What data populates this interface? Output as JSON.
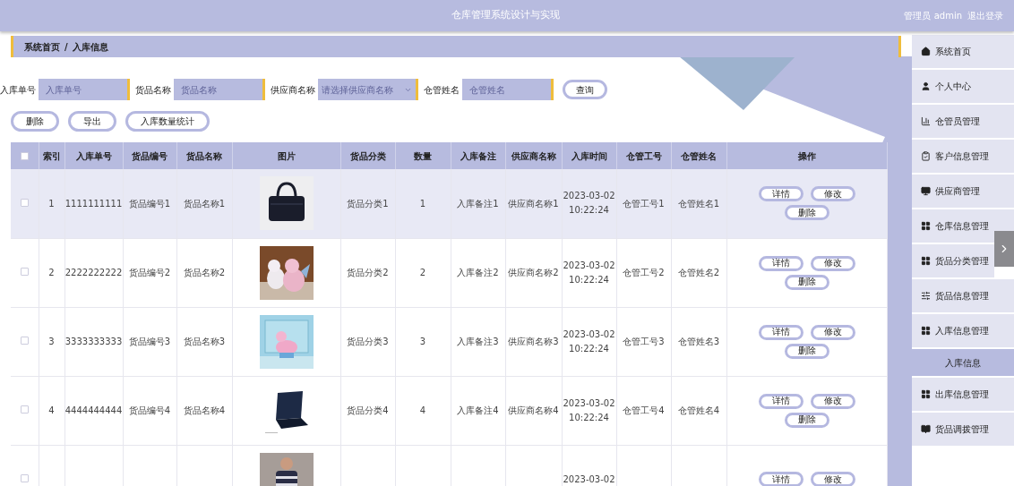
{
  "header": {
    "title": "仓库管理系统设计与实现",
    "user": "管理员 admin",
    "logout": "退出登录"
  },
  "breadcrumb": [
    "系统首页",
    "/",
    "入库信息"
  ],
  "search": [
    {
      "label": "入库单号",
      "placeholder": "入库单号",
      "kind": "input"
    },
    {
      "label": "货品名称",
      "placeholder": "货品名称",
      "kind": "input"
    },
    {
      "label": "供应商名称",
      "placeholder": "请选择供应商名称",
      "kind": "select"
    },
    {
      "label": "仓管姓名",
      "placeholder": "仓管姓名",
      "kind": "input"
    }
  ],
  "search_button": "查询",
  "actions": [
    "删除",
    "导出",
    "入库数量统计"
  ],
  "table": {
    "columns": [
      "索引",
      "入库单号",
      "货品编号",
      "货品名称",
      "图片",
      "货品分类",
      "数量",
      "入库备注",
      "供应商名称",
      "入库时间",
      "仓管工号",
      "仓管姓名",
      "操作"
    ],
    "header_checked": false,
    "rows": [
      {
        "highlighted": true,
        "checked": false,
        "index": "1",
        "order_no": "1111111111",
        "goods_no": "货品编号1",
        "goods_name": "货品名称1",
        "category": "货品分类1",
        "quantity": "1",
        "remark": "入库备注1",
        "supplier": "供应商名称1",
        "date": "2023-03-02",
        "time": "10:22:24",
        "keeper_no": "仓管工号1",
        "keeper_name": "仓管姓名1",
        "buttons": [
          "详情",
          "修改",
          "删除"
        ]
      },
      {
        "highlighted": false,
        "checked": false,
        "index": "2",
        "order_no": "2222222222",
        "goods_no": "货品编号2",
        "goods_name": "货品名称2",
        "category": "货品分类2",
        "quantity": "2",
        "remark": "入库备注2",
        "supplier": "供应商名称2",
        "date": "2023-03-02",
        "time": "10:22:24",
        "keeper_no": "仓管工号2",
        "keeper_name": "仓管姓名2",
        "buttons": [
          "详情",
          "修改",
          "删除"
        ]
      },
      {
        "highlighted": false,
        "checked": false,
        "index": "3",
        "order_no": "3333333333",
        "goods_no": "货品编号3",
        "goods_name": "货品名称3",
        "category": "货品分类3",
        "quantity": "3",
        "remark": "入库备注3",
        "supplier": "供应商名称3",
        "date": "2023-03-02",
        "time": "10:22:24",
        "keeper_no": "仓管工号3",
        "keeper_name": "仓管姓名3",
        "buttons": [
          "详情",
          "修改",
          "删除"
        ]
      },
      {
        "highlighted": false,
        "checked": false,
        "index": "4",
        "order_no": "4444444444",
        "goods_no": "货品编号4",
        "goods_name": "货品名称4",
        "category": "货品分类4",
        "quantity": "4",
        "remark": "入库备注4",
        "supplier": "供应商名称4",
        "date": "2023-03-02",
        "time": "10:22:24",
        "keeper_no": "仓管工号4",
        "keeper_name": "仓管姓名4",
        "buttons": [
          "详情",
          "修改",
          "删除"
        ]
      },
      {
        "highlighted": false,
        "checked": false,
        "date": "2023-03-02",
        "buttons": [
          "详情",
          "修改"
        ]
      }
    ]
  },
  "sidebar": [
    {
      "label": "系统首页",
      "selected": false
    },
    {
      "label": "个人中心",
      "selected": false
    },
    {
      "label": "仓管员管理",
      "selected": false
    },
    {
      "label": "客户信息管理",
      "selected": false
    },
    {
      "label": "供应商管理",
      "selected": false
    },
    {
      "label": "仓库信息管理",
      "selected": false
    },
    {
      "label": "货品分类管理",
      "selected": false
    },
    {
      "label": "货品信息管理",
      "selected": false
    },
    {
      "label": "入库信息管理",
      "selected": false
    },
    {
      "label": "入库信息",
      "selected": true
    },
    {
      "label": "出库信息管理",
      "selected": false
    },
    {
      "label": "货品调拨管理",
      "selected": false
    }
  ]
}
